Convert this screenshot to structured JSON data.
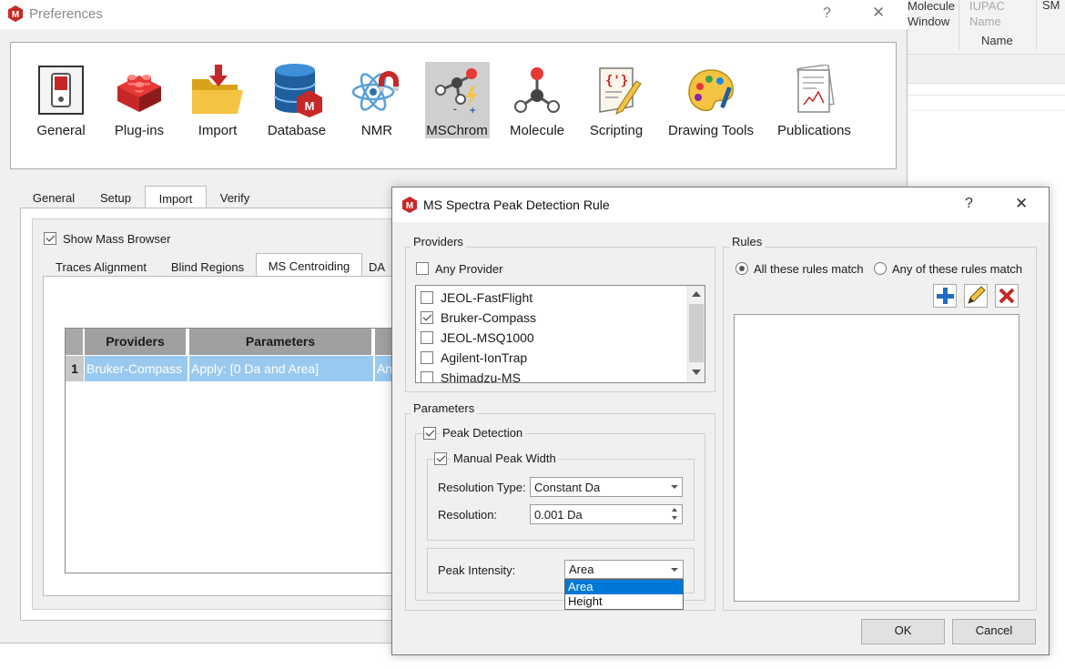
{
  "background_window": {
    "columns": [
      "Molecule Window",
      "IUPAC Name",
      "SM"
    ],
    "header_sub": "Name"
  },
  "preferences": {
    "title": "Preferences",
    "help_label": "?",
    "close_label": "✕",
    "categories": [
      {
        "label": "General",
        "icon": "switch-icon"
      },
      {
        "label": "Plug-ins",
        "icon": "lego-brick-icon"
      },
      {
        "label": "Import",
        "icon": "folder-import-icon"
      },
      {
        "label": "Database",
        "icon": "database-icon"
      },
      {
        "label": "NMR",
        "icon": "atom-magnet-icon"
      },
      {
        "label": "MSChrom",
        "icon": "ms-molecule-icon"
      },
      {
        "label": "Molecule",
        "icon": "molecule-icon"
      },
      {
        "label": "Scripting",
        "icon": "script-scroll-icon"
      },
      {
        "label": "Drawing Tools",
        "icon": "palette-icon"
      },
      {
        "label": "Publications",
        "icon": "publications-icon"
      }
    ],
    "selected_category": "MSChrom",
    "tabs": [
      "General",
      "Setup",
      "Import",
      "Verify"
    ],
    "active_tab": "Import",
    "show_mass_browser": "Show Mass Browser",
    "subtabs": [
      "Traces Alignment",
      "Blind Regions",
      "MS Centroiding",
      "DA"
    ],
    "active_subtab": "MS Centroiding",
    "table": {
      "headers": [
        "Providers",
        "Parameters",
        ""
      ],
      "rows": [
        {
          "num": "1",
          "provider": "Bruker-Compass",
          "parameters": "Apply: [0 Da and Area]",
          "extra": "An"
        }
      ]
    }
  },
  "dialog": {
    "title": "MS Spectra Peak Detection Rule",
    "help_label": "?",
    "close_label": "✕",
    "providers": {
      "group_label": "Providers",
      "any_provider": "Any Provider",
      "items": [
        {
          "label": "JEOL-FastFlight",
          "checked": false
        },
        {
          "label": "Bruker-Compass",
          "checked": true
        },
        {
          "label": "JEOL-MSQ1000",
          "checked": false
        },
        {
          "label": "Agilent-IonTrap",
          "checked": false
        },
        {
          "label": "Shimadzu-MS",
          "checked": false
        }
      ]
    },
    "parameters": {
      "group_label": "Parameters",
      "peak_detection": "Peak Detection",
      "manual_peak_width": "Manual Peak Width",
      "resolution_type_label": "Resolution Type:",
      "resolution_type_value": "Constant Da",
      "resolution_label": "Resolution:",
      "resolution_value": "0.001 Da",
      "peak_intensity_label": "Peak Intensity:",
      "peak_intensity_value": "Area",
      "peak_intensity_options": [
        "Area",
        "Height"
      ]
    },
    "rules": {
      "group_label": "Rules",
      "all_match": "All these rules match",
      "any_match": "Any of these rules match"
    },
    "ok_label": "OK",
    "cancel_label": "Cancel"
  },
  "colors": {
    "brand_red": "#c62828",
    "selection_blue": "#99c9ef",
    "dropdown_highlight": "#0078d7",
    "table_header": "#a0a0a0"
  }
}
